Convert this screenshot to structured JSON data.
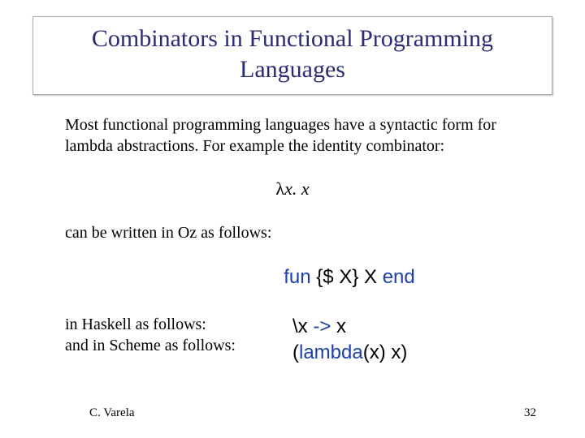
{
  "title": "Combinators in Functional Programming Languages",
  "intro": "Most functional programming languages have a syntactic form for lambda abstractions.  For example the identity combinator:",
  "lambda": {
    "lam": "λ",
    "rest": "x. x"
  },
  "oz_intro": "can be written in Oz as follows:",
  "oz": {
    "kw1": "fun",
    "mid": " {$ X} X ",
    "kw2": "end"
  },
  "haskell_label": "in Haskell as follows:",
  "scheme_label": "and in Scheme as follows:",
  "haskell": {
    "pre": "\\x ",
    "arrow": "->",
    "post": " x"
  },
  "scheme": {
    "open": "(",
    "kw": "lambda",
    "rest": "(x) x)"
  },
  "footer": {
    "author": "C. Varela",
    "page": "32"
  }
}
